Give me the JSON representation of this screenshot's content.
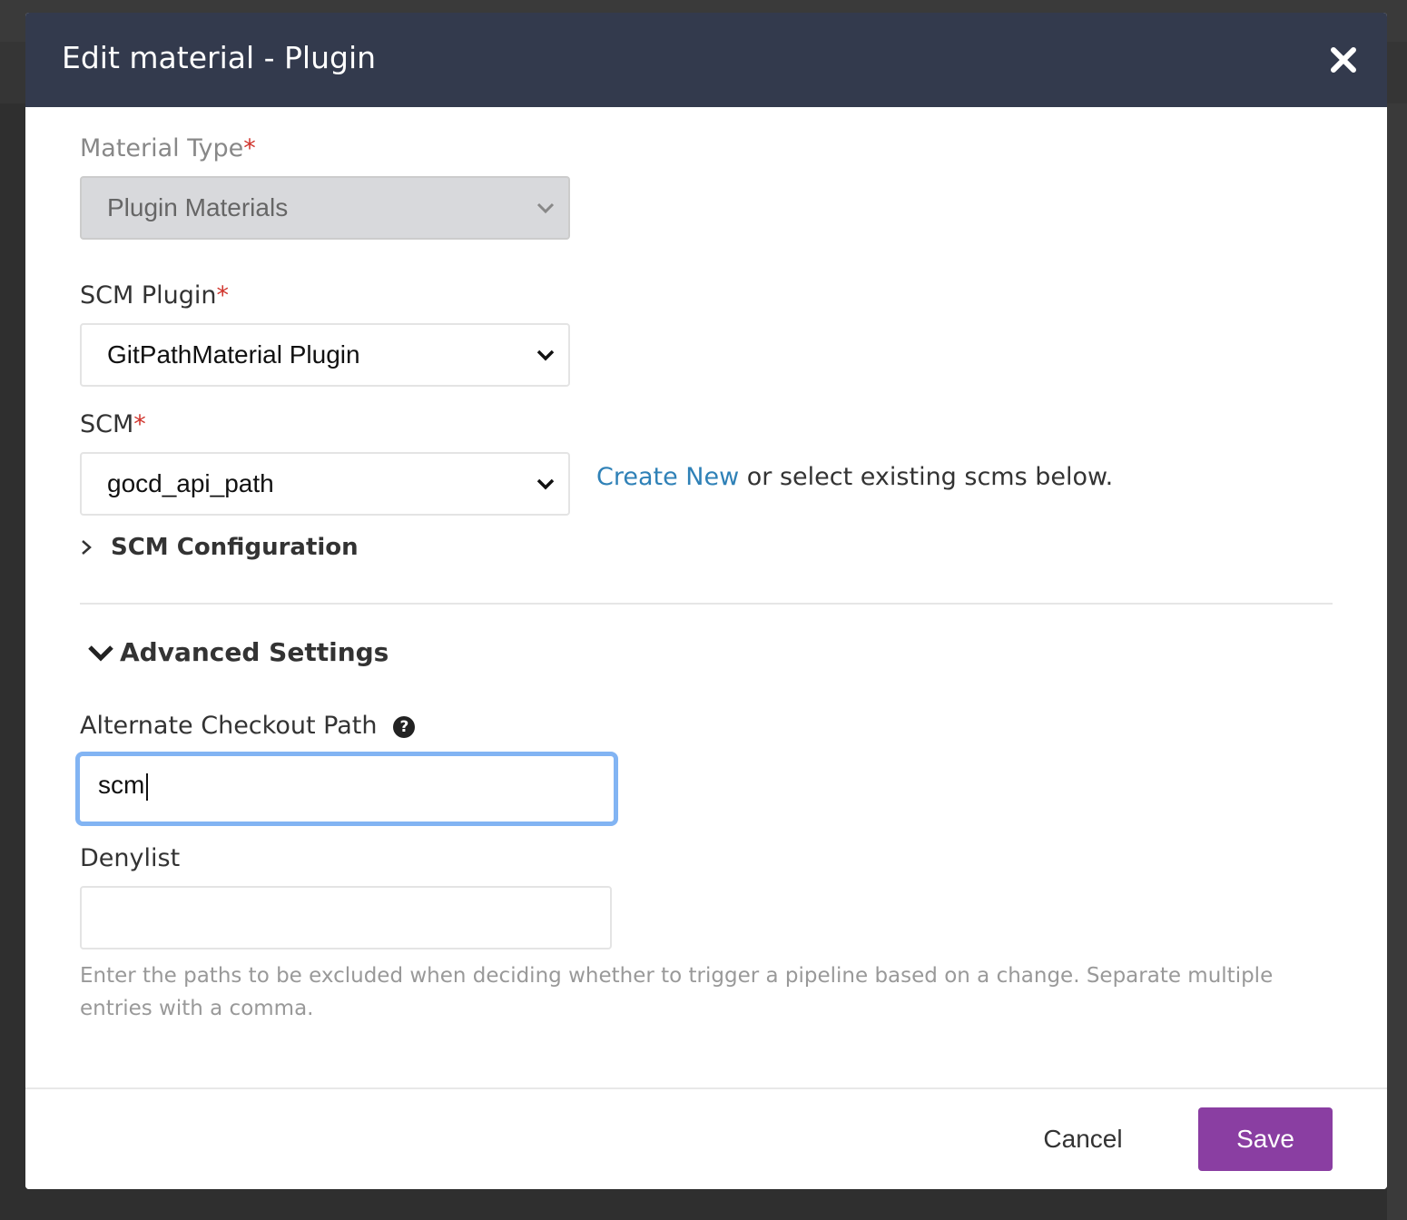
{
  "modal": {
    "title": "Edit material - Plugin"
  },
  "material_type": {
    "label": "Material Type",
    "required_mark": "*",
    "value": "Plugin Materials"
  },
  "scm_plugin": {
    "label": "SCM Plugin",
    "required_mark": "*",
    "value": "GitPathMaterial Plugin"
  },
  "scm": {
    "label": "SCM",
    "required_mark": "*",
    "value": "gocd_api_path",
    "create_new_link": "Create New",
    "create_new_suffix": " or select existing scms below."
  },
  "scm_configuration": {
    "label": "SCM Configuration"
  },
  "advanced_settings": {
    "label": "Advanced Settings"
  },
  "alternate_checkout_path": {
    "label": "Alternate Checkout Path",
    "help_glyph": "?",
    "value": "scm"
  },
  "denylist": {
    "label": "Denylist",
    "value": "",
    "hint": "Enter the paths to be excluded when deciding whether to trigger a pipeline based on a change. Separate multiple entries with a comma."
  },
  "footer": {
    "cancel_label": "Cancel",
    "save_label": "Save"
  },
  "colors": {
    "header_bg": "#333a4d",
    "link": "#2f81b7",
    "save_button": "#8a3ea2",
    "focus_ring": "#82b4f3",
    "required": "#d0342c"
  }
}
